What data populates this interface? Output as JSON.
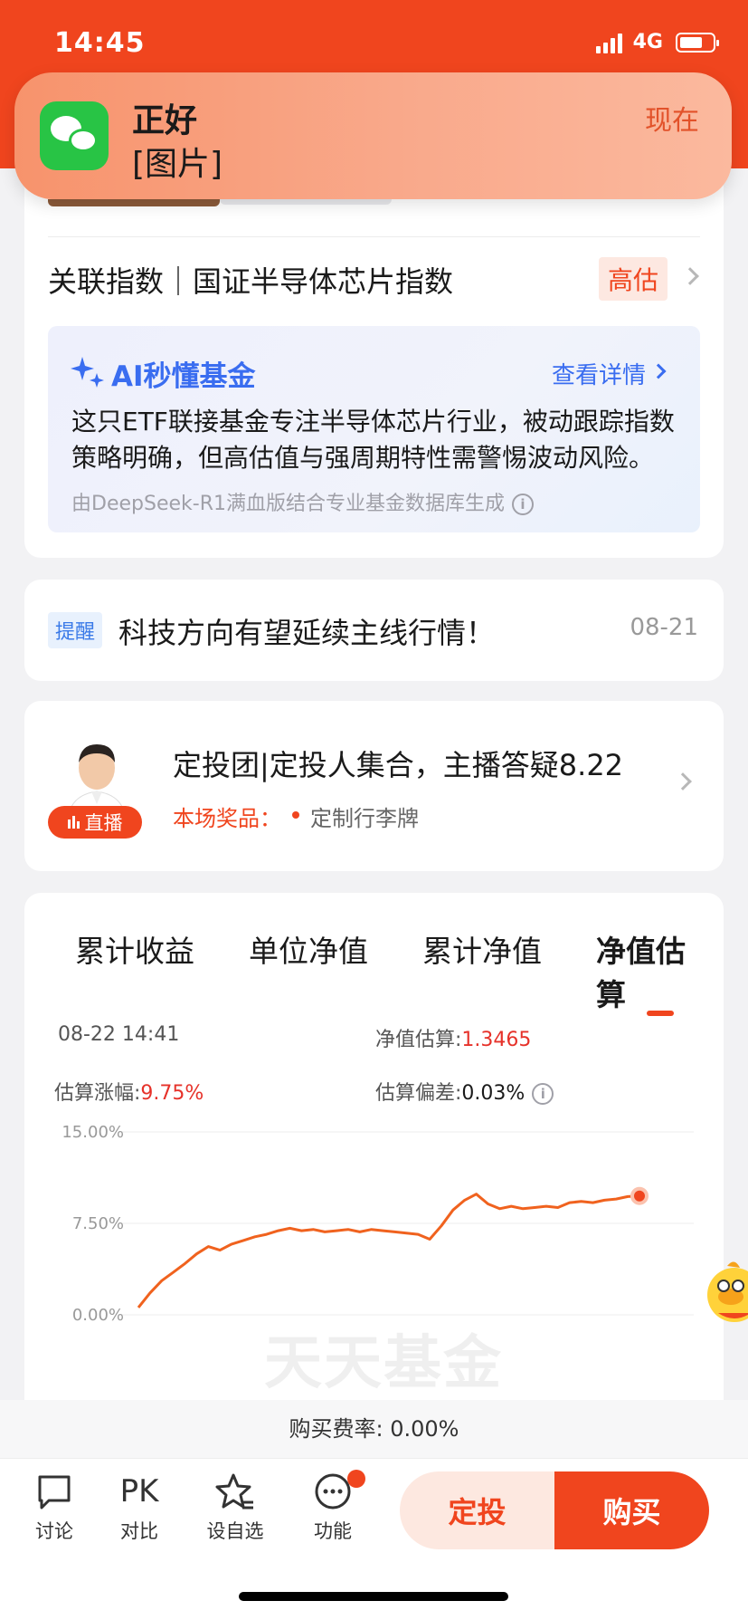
{
  "status_bar": {
    "time": "14:45",
    "network": "4G"
  },
  "notification": {
    "sender": "正好",
    "message": "[图片]",
    "time": "现在",
    "app_icon": "wechat-icon"
  },
  "related_index": {
    "label": "关联指数｜国证半导体芯片指数",
    "badge": "高估"
  },
  "ai_box": {
    "title": "AI秒懂基金",
    "link": "查看详情",
    "summary": "这只ETF联接基金专注半导体芯片行业，被动跟踪指数策略明确，但高估值与强周期特性需警惕波动风险。",
    "source": "由DeepSeek-R1满血版结合专业基金数据库生成"
  },
  "reminder": {
    "tag": "提醒",
    "text": "科技方向有望延续主线行情！",
    "date": "08-21"
  },
  "live": {
    "badge": "直播",
    "title": "定投团|定投人集合，主播答疑8.22",
    "prize_label": "本场奖品：",
    "prize": "定制行李牌"
  },
  "tabs": [
    {
      "label": "累计收益"
    },
    {
      "label": "单位净值"
    },
    {
      "label": "累计净值"
    },
    {
      "label": "净值估算",
      "active": true
    }
  ],
  "estimate": {
    "datetime": "08-22 14:41",
    "nav_label": "净值估算:",
    "nav_value": "1.3465",
    "change_label": "估算涨幅:",
    "change_value": "9.75%",
    "deviation_label": "估算偏差:",
    "deviation_value": "0.03%"
  },
  "chart_data": {
    "type": "line",
    "y_tick_labels": [
      "15.00%",
      "7.50%",
      "0.00%"
    ],
    "ylim": [
      0,
      15
    ],
    "series": [
      {
        "color": "#f0621e",
        "values": [
          0.6,
          1.8,
          2.8,
          3.5,
          4.2,
          5.0,
          5.6,
          5.3,
          5.8,
          6.1,
          6.4,
          6.6,
          6.9,
          7.1,
          6.9,
          7.0,
          6.8,
          6.9,
          7.0,
          6.8,
          7.0,
          6.9,
          6.8,
          6.7,
          6.6,
          6.2,
          7.3,
          8.6,
          9.4,
          9.9,
          9.1,
          8.7,
          8.9,
          8.7,
          8.8,
          8.9,
          8.8,
          9.2,
          9.3,
          9.2,
          9.4,
          9.5,
          9.7,
          9.75
        ],
        "end_marker": true
      }
    ],
    "grid": true,
    "watermark": "天天基金"
  },
  "fee": {
    "text": "购买费率: 0.00%"
  },
  "bottom_bar": {
    "items": [
      {
        "label": "讨论",
        "icon": "chat-bubble-icon"
      },
      {
        "label": "对比",
        "icon": "pk-icon",
        "glyph": "PK"
      },
      {
        "label": "设自选",
        "icon": "star-add-icon"
      },
      {
        "label": "功能",
        "icon": "more-icon"
      }
    ],
    "plan_button": "定投",
    "buy_button": "购买"
  },
  "colors": {
    "brand": "#f0451e",
    "ai_blue": "#3a6df0",
    "positive": "#e6322a"
  }
}
